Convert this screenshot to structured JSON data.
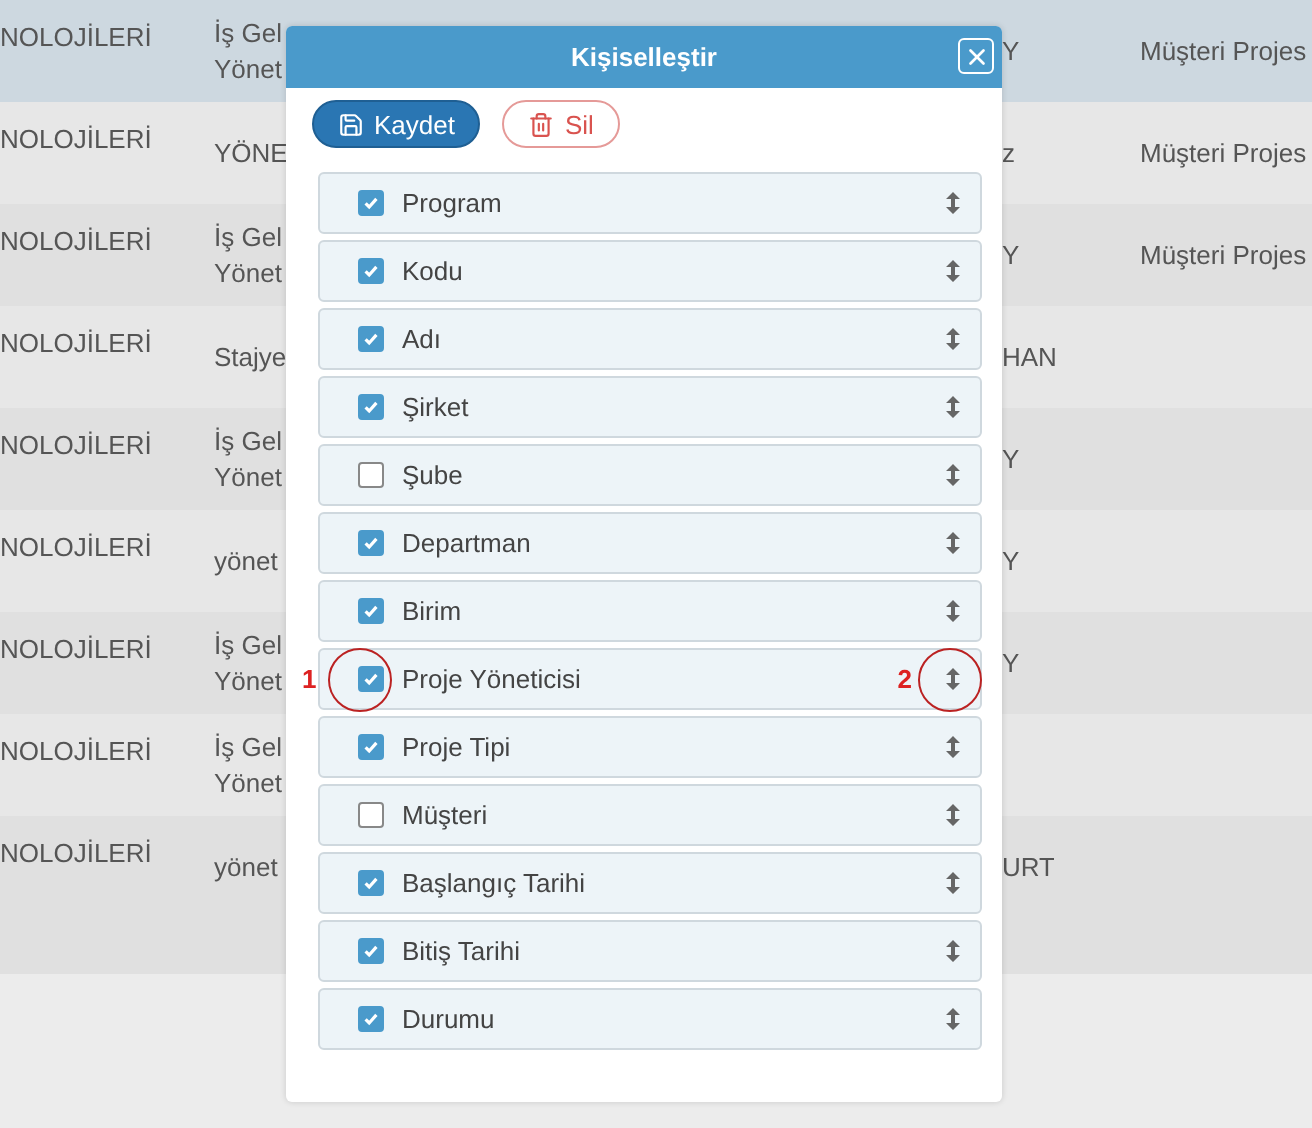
{
  "table": {
    "rows": [
      {
        "selected": true,
        "cells": [
          "NOLOJİLERİ",
          "İş Gel\nYönet",
          "Y",
          "Müşteri Projes"
        ]
      },
      {
        "selected": false,
        "cells": [
          "NOLOJİLERİ",
          "YÖNE",
          "z",
          "Müşteri Projes"
        ]
      },
      {
        "selected": false,
        "cells": [
          "NOLOJİLERİ",
          "İş Gel\nYönet",
          "Y",
          "Müşteri Projes"
        ]
      },
      {
        "selected": false,
        "cells": [
          "NOLOJİLERİ",
          "Stajye",
          "HAN",
          ""
        ]
      },
      {
        "selected": false,
        "cells": [
          "NOLOJİLERİ",
          "İş Gel\nYönet",
          "Y",
          ""
        ]
      },
      {
        "selected": false,
        "cells": [
          "NOLOJİLERİ",
          "yönet",
          "Y",
          ""
        ]
      },
      {
        "selected": false,
        "cells": [
          "NOLOJİLERİ",
          "İş Gel\nYönet",
          "Y",
          ""
        ]
      },
      {
        "selected": false,
        "cells": [
          "NOLOJİLERİ",
          "İş Gel\nYönet",
          "",
          ""
        ]
      },
      {
        "selected": false,
        "cells": [
          "NOLOJİLERİ",
          "yönet",
          "URT",
          ""
        ]
      }
    ]
  },
  "dialog": {
    "title": "Kişiselleştir",
    "buttons": [
      {
        "kind": "save",
        "label": "Kaydet"
      },
      {
        "kind": "delete",
        "label": "Sil"
      }
    ],
    "columns": [
      {
        "label": "Program",
        "checked": true
      },
      {
        "label": "Kodu",
        "checked": true
      },
      {
        "label": "Adı",
        "checked": true
      },
      {
        "label": "Şirket",
        "checked": true
      },
      {
        "label": "Şube",
        "checked": false
      },
      {
        "label": "Departman",
        "checked": true
      },
      {
        "label": "Birim",
        "checked": true
      },
      {
        "label": "Proje Yöneticisi",
        "checked": true,
        "callouts": [
          {
            "kind": "checkbox",
            "label": "1"
          },
          {
            "kind": "handle",
            "label": "2"
          }
        ]
      },
      {
        "label": "Proje Tipi",
        "checked": true
      },
      {
        "label": "Müşteri",
        "checked": false
      },
      {
        "label": "Başlangıç Tarihi",
        "checked": true
      },
      {
        "label": "Bitiş Tarihi",
        "checked": true
      },
      {
        "label": "Durumu",
        "checked": true
      }
    ]
  }
}
